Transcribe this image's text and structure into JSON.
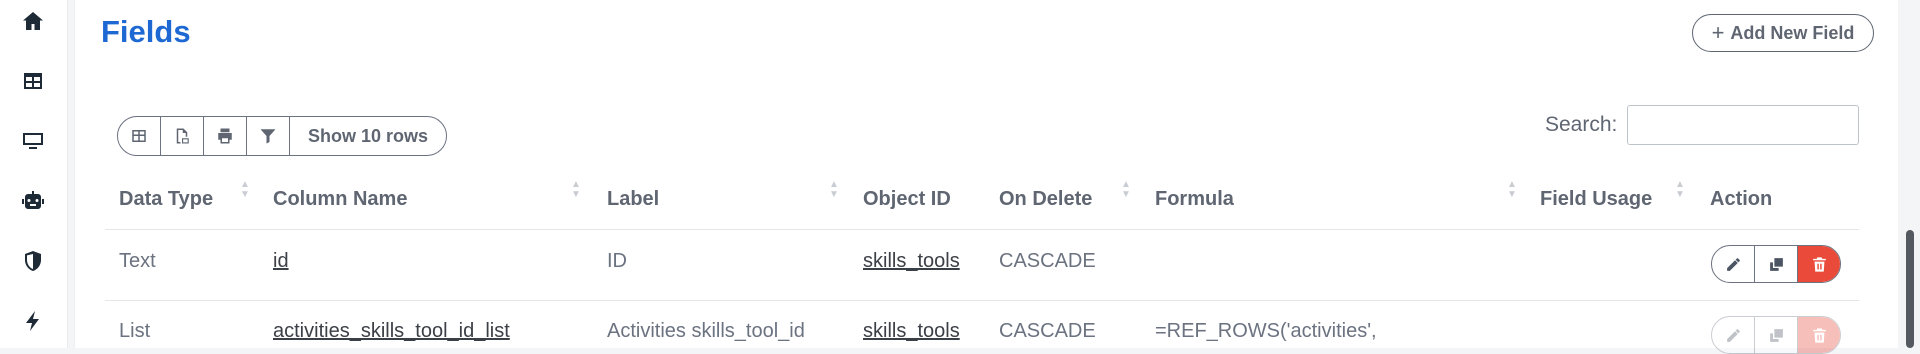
{
  "sidebar": {
    "items": [
      {
        "icon": "home-icon"
      },
      {
        "icon": "table-icon"
      },
      {
        "icon": "monitor-icon"
      },
      {
        "icon": "robot-icon"
      },
      {
        "icon": "shield-icon"
      },
      {
        "icon": "bolt-icon"
      }
    ]
  },
  "header": {
    "title": "Fields",
    "add_button_label": "Add New Field",
    "add_button_plus": "+"
  },
  "toolbar": {
    "buttons": [
      {
        "icon": "columns-icon"
      },
      {
        "icon": "csv-icon"
      },
      {
        "icon": "print-icon"
      },
      {
        "icon": "filter-icon"
      }
    ],
    "show_rows_label": "Show 10 rows"
  },
  "search": {
    "label": "Search:",
    "value": ""
  },
  "table": {
    "columns": [
      "Data Type",
      "Column Name",
      "Label",
      "Object ID",
      "On Delete",
      "Formula",
      "Field Usage",
      "Action"
    ],
    "rows": [
      {
        "data_type": "Text",
        "column_name": "id",
        "label": "ID",
        "object_id": "skills_tools",
        "on_delete": "CASCADE",
        "formula": "",
        "field_usage": ""
      },
      {
        "data_type": "List",
        "column_name": "activities_skills_tool_id_list",
        "label": "Activities skills_tool_id",
        "object_id": "skills_tools",
        "on_delete": "CASCADE",
        "formula": "=REF_ROWS('activities',",
        "field_usage": ""
      }
    ]
  },
  "colors": {
    "title": "#1d68d3",
    "delete": "#ea4a3a",
    "text": "#5f6672"
  }
}
